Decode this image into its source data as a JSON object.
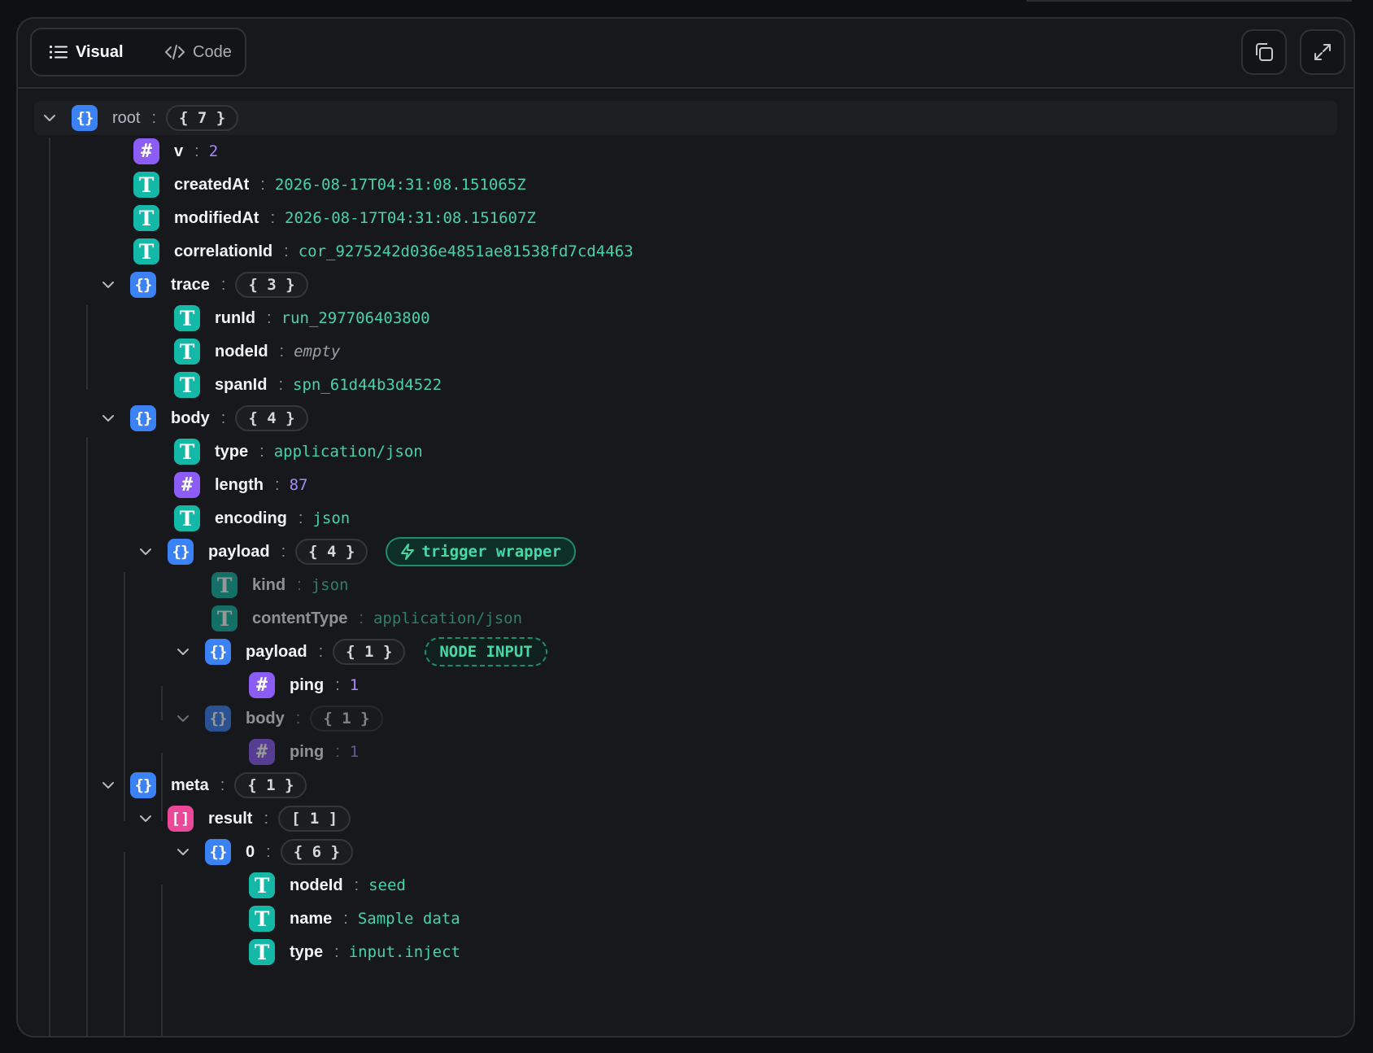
{
  "toolbar": {
    "view_tabs": [
      {
        "label": "Visual",
        "icon": "list-icon",
        "active": true
      },
      {
        "label": "Code",
        "icon": "code-icon",
        "active": false
      }
    ],
    "actions": [
      {
        "name": "copy",
        "icon": "copy-icon"
      },
      {
        "name": "expand",
        "icon": "expand-icon"
      }
    ]
  },
  "tree": {
    "separator": ":",
    "root": {
      "key": "root",
      "count": "{ 7 }"
    },
    "v": {
      "key": "v",
      "value": "2"
    },
    "createdAt": {
      "key": "createdAt",
      "value": "2026-08-17T04:31:08.151065Z"
    },
    "modifiedAt": {
      "key": "modifiedAt",
      "value": "2026-08-17T04:31:08.151607Z"
    },
    "correlationId": {
      "key": "correlationId",
      "value": "cor_9275242d036e4851ae81538fd7cd4463"
    },
    "trace": {
      "key": "trace",
      "count": "{ 3 }",
      "runId": {
        "key": "runId",
        "value": "run_297706403800"
      },
      "nodeId": {
        "key": "nodeId",
        "value": "empty"
      },
      "spanId": {
        "key": "spanId",
        "value": "spn_61d44b3d4522"
      }
    },
    "body": {
      "key": "body",
      "count": "{ 4 }",
      "type": {
        "key": "type",
        "value": "application/json"
      },
      "length": {
        "key": "length",
        "value": "87"
      },
      "encoding": {
        "key": "encoding",
        "value": "json"
      },
      "payload": {
        "key": "payload",
        "count": "{ 4 }",
        "badge": "trigger wrapper",
        "kind": {
          "key": "kind",
          "value": "json"
        },
        "contentType": {
          "key": "contentType",
          "value": "application/json"
        },
        "payload": {
          "key": "payload",
          "count": "{ 1 }",
          "badge": "NODE INPUT",
          "ping": {
            "key": "ping",
            "value": "1"
          }
        },
        "body": {
          "key": "body",
          "count": "{ 1 }",
          "ping": {
            "key": "ping",
            "value": "1"
          }
        }
      }
    },
    "meta": {
      "key": "meta",
      "count": "{ 1 }",
      "result": {
        "key": "result",
        "count": "[ 1 ]",
        "item0": {
          "key": "0",
          "count": "{ 6 }",
          "nodeId": {
            "key": "nodeId",
            "value": "seed"
          },
          "name": {
            "key": "name",
            "value": "Sample data"
          },
          "type": {
            "key": "type",
            "value": "input.inject"
          }
        }
      }
    }
  },
  "icon_glyphs": {
    "object": "{}",
    "number": "#",
    "string": "T",
    "array": "[]"
  },
  "colors": {
    "object_icon": "#3b82f6",
    "number_icon": "#8b5cf6",
    "string_icon": "#14b8a6",
    "array_icon": "#ec4899",
    "string_value": "#46d3a6",
    "number_value": "#a78bfa",
    "background": "#16181b"
  }
}
